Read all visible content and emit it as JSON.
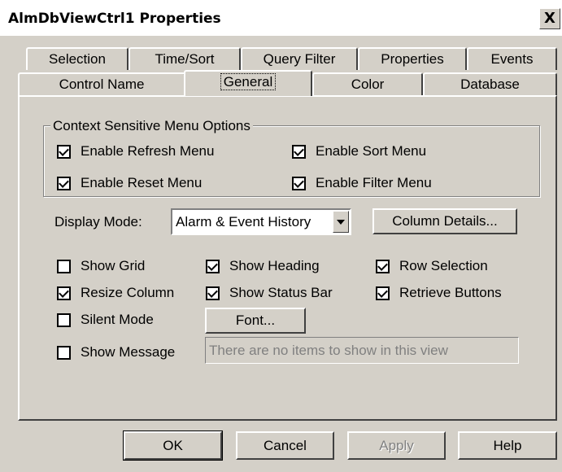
{
  "window": {
    "title": "AlmDbViewCtrl1 Properties",
    "close_glyph": "X"
  },
  "tabs_row1": [
    {
      "label": "Selection"
    },
    {
      "label": "Time/Sort"
    },
    {
      "label": "Query Filter"
    },
    {
      "label": "Properties"
    },
    {
      "label": "Events"
    }
  ],
  "tabs_row2": [
    {
      "label": "Control Name"
    },
    {
      "label": "General",
      "active": true
    },
    {
      "label": "Color"
    },
    {
      "label": "Database"
    }
  ],
  "context_menu": {
    "title": "Context Sensitive Menu Options",
    "options": [
      {
        "label": "Enable Refresh Menu",
        "checked": true
      },
      {
        "label": "Enable Sort Menu",
        "checked": true
      },
      {
        "label": "Enable Reset Menu",
        "checked": true
      },
      {
        "label": "Enable Filter Menu",
        "checked": true
      }
    ]
  },
  "display_mode": {
    "label": "Display Mode:",
    "value": "Alarm & Event History",
    "column_details_label": "Column Details..."
  },
  "options": [
    {
      "label": "Show Grid",
      "checked": false
    },
    {
      "label": "Show Heading",
      "checked": true
    },
    {
      "label": "Row Selection",
      "checked": true
    },
    {
      "label": "Resize Column",
      "checked": true
    },
    {
      "label": "Show Status Bar",
      "checked": true
    },
    {
      "label": "Retrieve Buttons",
      "checked": true
    },
    {
      "label": "Silent Mode",
      "checked": false
    },
    {
      "label": "Show Message",
      "checked": false
    }
  ],
  "font_button_label": "Font...",
  "message_text": "There are no items to show in this view",
  "buttons": {
    "ok": "OK",
    "cancel": "Cancel",
    "apply": "Apply",
    "help": "Help"
  }
}
